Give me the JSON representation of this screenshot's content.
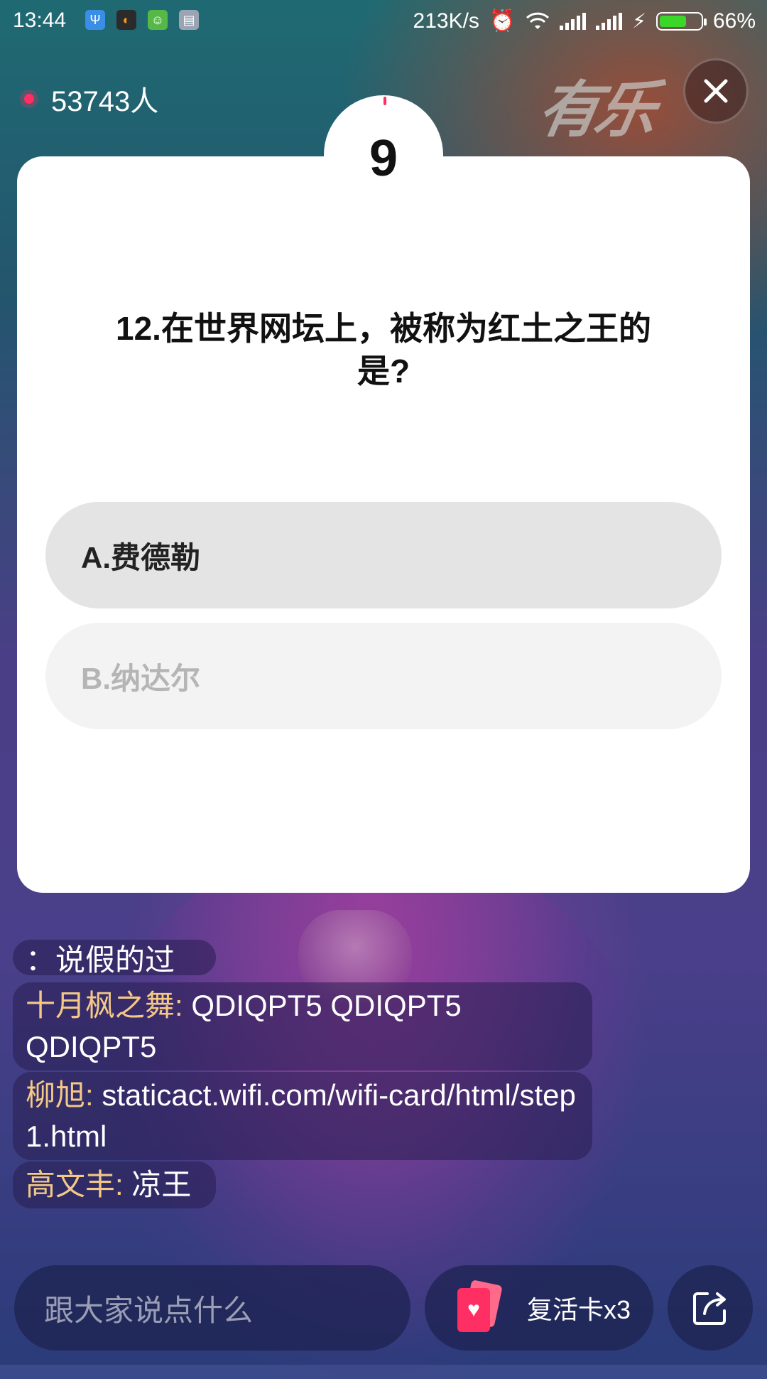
{
  "status_bar": {
    "time": "13:44",
    "speed": "213K/s",
    "battery_percent": "66%",
    "battery_level": 0.66,
    "icons": [
      "usb-icon",
      "vpn-icon",
      "android-icon",
      "message-icon",
      "alarm-icon",
      "wifi-icon",
      "signal-icon",
      "signal-icon",
      "charging-icon"
    ]
  },
  "header": {
    "viewer_count": "53743人",
    "brand_logo": "有乐",
    "close_icon": "close-icon",
    "live_dot_color": "#ff2e63"
  },
  "quiz": {
    "countdown": "9",
    "question": "12.在世界网坛上，被称为红土之王的是?",
    "options": [
      {
        "label": "A.费德勒"
      },
      {
        "label": "B.纳达尔"
      }
    ]
  },
  "comments": [
    {
      "user": "",
      "text": "：说假的过"
    },
    {
      "user": "十月枫之舞:",
      "text": "QDIQPT5    QDIQPT5 QDIQPT5"
    },
    {
      "user": "柳旭:",
      "text": "staticact.wifi.com/wifi-card/html/step1.html"
    },
    {
      "user": "高文丰:",
      "text": "凉王"
    }
  ],
  "bottom_bar": {
    "chat_placeholder": "跟大家说点什么",
    "revive_label": "复活卡x3",
    "share_icon": "share-icon"
  },
  "colors": {
    "accent": "#ff2e63",
    "username": "#f4c987",
    "option_selected_bg": "#e4e4e4",
    "option_disabled_bg": "#f3f3f3"
  }
}
